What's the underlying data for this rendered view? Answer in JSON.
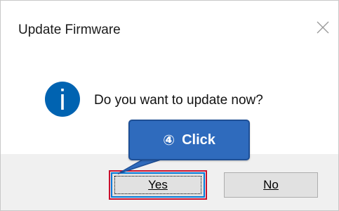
{
  "dialog": {
    "title": "Update Firmware",
    "close_icon": "close-icon",
    "message": "Do you want to update now?",
    "info_icon": "info-icon",
    "buttons": {
      "yes_label": "Yes",
      "no_label": "No"
    }
  },
  "annotation": {
    "step_number": "④",
    "label": "Click",
    "background_color": "#2f6bbd",
    "highlight_color": "#c8102e"
  },
  "colors": {
    "accent": "#0078d7",
    "info_blue": "#0063b1",
    "button_area": "#f0f0f0"
  }
}
